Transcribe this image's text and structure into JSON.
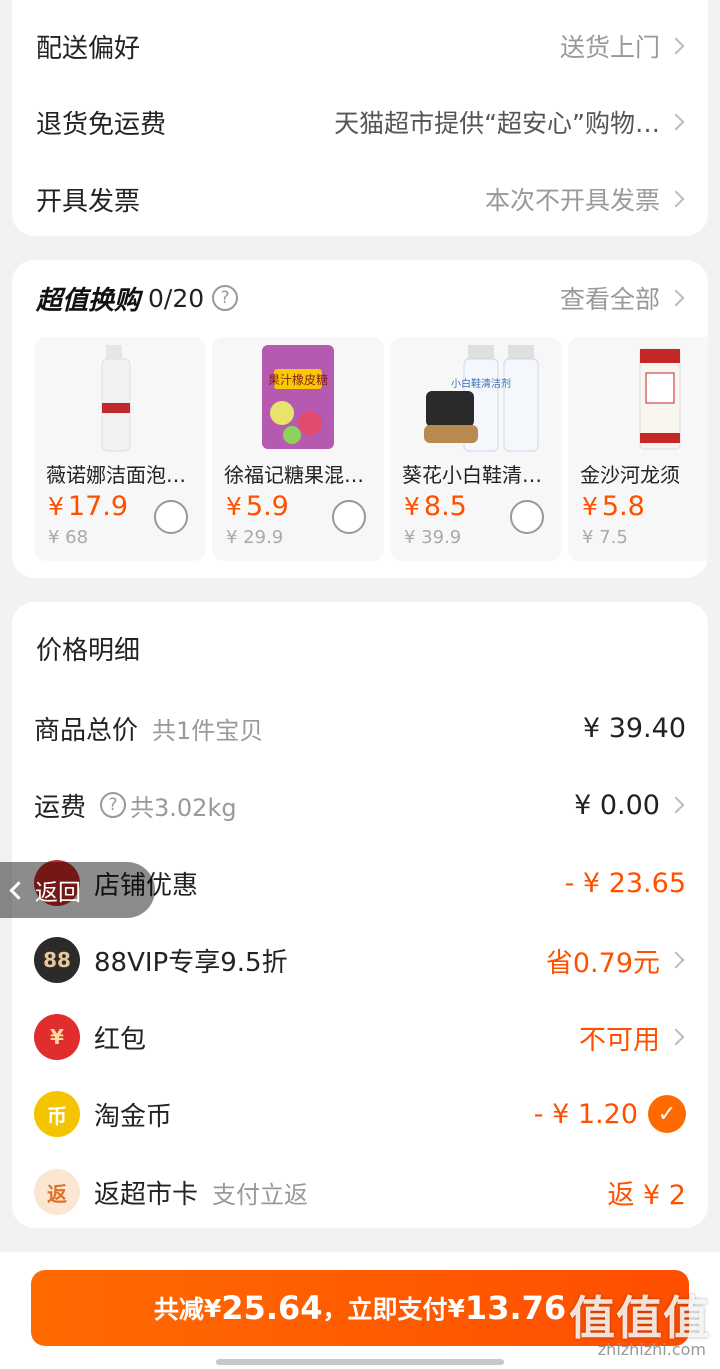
{
  "delivery": {
    "rows": [
      {
        "label": "配送偏好",
        "value": "送货上门"
      },
      {
        "label": "退货免运费",
        "value": "天猫超市提供“超安心”购物…"
      },
      {
        "label": "开具发票",
        "value": "本次不开具发票"
      }
    ]
  },
  "swap": {
    "title": "超值换购",
    "count": "0/20",
    "help_icon": "?",
    "view_all": "查看全部",
    "products": [
      {
        "name": "薇诺娜洁面泡…",
        "currency": "¥",
        "price": "17.9",
        "orig": "¥ 68",
        "icon": "foam-bottle"
      },
      {
        "name": "徐福记糖果混…",
        "currency": "¥",
        "price": "5.9",
        "orig": "¥ 29.9",
        "icon": "candy-bag",
        "img_text": "果汁橡皮糖"
      },
      {
        "name": "葵花小白鞋清…",
        "currency": "¥",
        "price": "8.5",
        "orig": "¥ 39.9",
        "icon": "shoe-cleaner",
        "img_text": "小白鞋清洁剂"
      },
      {
        "name": "金沙河龙须",
        "currency": "¥",
        "price": "5.8",
        "orig": "¥ 7.5",
        "icon": "noodle-pack"
      }
    ]
  },
  "price": {
    "title": "价格明细",
    "total": {
      "label": "商品总价",
      "sub": "共1件宝贝",
      "value": "¥ 39.40"
    },
    "shipping": {
      "label": "运费",
      "sub": "共3.02kg",
      "value": "¥ 0.00"
    },
    "store": {
      "label": "店铺优惠",
      "value": "- ¥ 23.65"
    },
    "vip": {
      "label": "88VIP专享9.5折",
      "value": "省0.79元",
      "icon_text": "88"
    },
    "redpacket": {
      "label": "红包",
      "value": "不可用",
      "icon_text": "¥"
    },
    "coin": {
      "label": "淘金币",
      "value": "- ¥ 1.20",
      "icon_text": "币"
    },
    "card": {
      "label": "返超市卡",
      "sub": "支付立返",
      "value": "返 ¥ 2",
      "icon_text": "返"
    }
  },
  "back": {
    "label": "返回"
  },
  "pay": {
    "prefix": "共减",
    "reduce_currency": "¥",
    "reduce": "25.64",
    "mid": "，立即支付",
    "pay_currency": "¥",
    "amount": "13.76"
  },
  "watermark": {
    "text": "值值值",
    "sub": "zhizhizhi.com"
  },
  "colors": {
    "accent": "#ff5000",
    "gray": "#999999"
  }
}
